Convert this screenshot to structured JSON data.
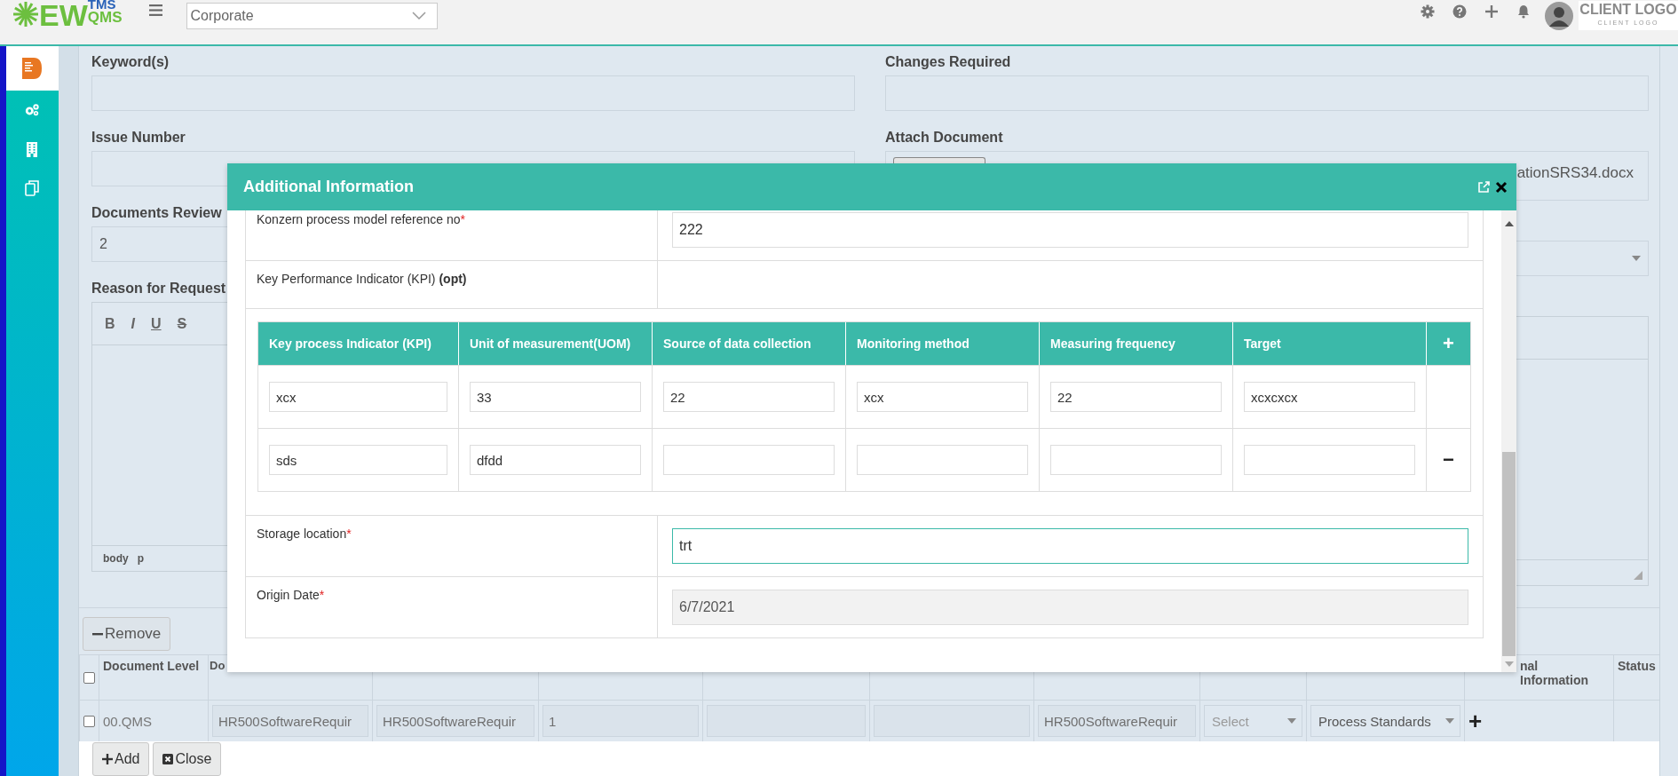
{
  "header": {
    "logo": {
      "main": "EW",
      "top": "TMS",
      "bottom": "QMS"
    },
    "site_select": "Corporate",
    "client_logo": {
      "title": "CLIENT LOGO",
      "subtitle": "CLIENT LOGO"
    }
  },
  "sidebar": {
    "items": [
      {
        "kind": "document",
        "selected": true
      },
      {
        "kind": "gears",
        "selected": false
      },
      {
        "kind": "building",
        "selected": false
      },
      {
        "kind": "copy",
        "selected": false
      }
    ]
  },
  "form": {
    "left": [
      {
        "kind": "text",
        "label": "Keyword(s)"
      },
      {
        "kind": "text",
        "label": "Issue Number"
      },
      {
        "kind": "text",
        "label": "Documents Review",
        "value": "2"
      },
      {
        "kind": "editor",
        "label": "Reason for Request",
        "toolbar": [
          {
            "kind": "bold",
            "label": "B"
          },
          {
            "kind": "italic",
            "label": "I"
          },
          {
            "kind": "underline",
            "label": "U"
          },
          {
            "kind": "strike",
            "label": "S"
          }
        ],
        "path": [
          "body",
          "p"
        ]
      }
    ],
    "right": [
      {
        "kind": "text",
        "label": "Changes Required"
      },
      {
        "kind": "file",
        "label": "Attach Document",
        "value": "ationSRS34.docx"
      },
      {
        "kind": "select"
      },
      {
        "kind": "editor_box"
      }
    ]
  },
  "remove_button": "Remove",
  "table": {
    "select_all": false,
    "columns": [
      {
        "label": "Document Level"
      },
      {
        "label": "Do"
      },
      {},
      {},
      {},
      {},
      {},
      {},
      {},
      {
        "label": "nal Information"
      },
      {
        "label": "Status"
      }
    ],
    "rows": [
      {
        "selected": false,
        "cells": [
          {
            "kind": "text",
            "value": "00.QMS"
          },
          {
            "kind": "input",
            "value": "HR500SoftwareRequir"
          },
          {
            "kind": "input",
            "value": "HR500SoftwareRequir"
          },
          {
            "kind": "input",
            "value": "1"
          },
          {
            "kind": "input"
          },
          {
            "kind": "input"
          },
          {
            "kind": "input",
            "value": "HR500SoftwareRequir"
          },
          {
            "kind": "select",
            "placeholder": "Select"
          },
          {
            "kind": "select",
            "value": "Process Standards"
          },
          {
            "kind": "add",
            "value": "+"
          },
          {
            "kind": "empty"
          }
        ]
      }
    ]
  },
  "buttons": [
    {
      "kind": "add",
      "label": "Add"
    },
    {
      "kind": "close",
      "label": "Close"
    }
  ],
  "modal": {
    "title": "Additional Information",
    "rows": [
      {
        "kind": "input",
        "label": "Konzern process model reference no",
        "required_mark": "*",
        "value": "222",
        "focused": false,
        "disabled": false
      },
      {
        "kind": "heading",
        "label": "Key Performance Indicator (KPI) **(opt)**"
      },
      {
        "kind": "kpi_table"
      },
      {
        "kind": "input",
        "label": "Storage location",
        "required_mark": "*",
        "value": "trt",
        "focused": true,
        "disabled": false
      },
      {
        "kind": "input",
        "label": "Origin Date",
        "required_mark": "*",
        "value": "6/7/2021",
        "focused": false,
        "disabled": true
      }
    ],
    "kpi": {
      "columns": [
        "Key process Indicator (KPI)",
        "Unit of measurement(UOM)",
        "Source of data collection",
        "Monitoring method",
        "Measuring frequency",
        "Target"
      ],
      "add_label": "+",
      "rows": [
        {
          "cells": [
            "xcx",
            "33",
            "22",
            "xcx",
            "22",
            "xcxcxcx"
          ]
        },
        {
          "cells": [
            "sds",
            "dfdd"
          ],
          "remove_label": "−"
        }
      ]
    }
  }
}
